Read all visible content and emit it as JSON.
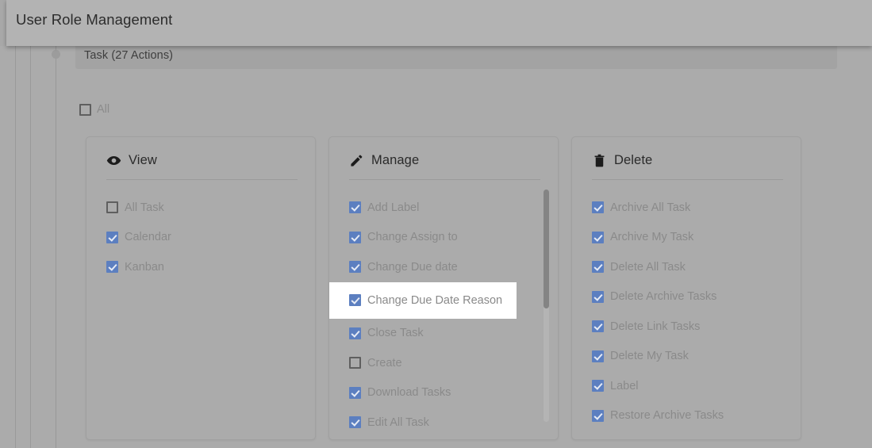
{
  "window": {
    "title": "User Role Management"
  },
  "tree": {
    "node_label": "Task  (27 Actions)"
  },
  "master": {
    "all_label": "All",
    "all_checked": false
  },
  "colors": {
    "checkbox_checked": "#5c7fc0",
    "checkbox_check_mark": "#e6ebf5",
    "checkbox_unchecked_border": "#5f5f5f",
    "page_background": "#ababab",
    "title_bar": "#b3b3b3",
    "task_band": "#a3a3a3",
    "highlight_row": "#ffffff",
    "scrollbar_thumb": "#848484",
    "scrollbar_track": "#b4b4b4",
    "label_text": "#8a8a8a",
    "heading_text": "#2a2a2a"
  },
  "cards": [
    {
      "id": "view",
      "title": "View",
      "icon": "eye-icon",
      "has_scrollbar": false,
      "options": [
        {
          "label": "All Task",
          "checked": false,
          "highlighted": false
        },
        {
          "label": "Calendar",
          "checked": true,
          "highlighted": false
        },
        {
          "label": "Kanban",
          "checked": true,
          "highlighted": false
        }
      ]
    },
    {
      "id": "manage",
      "title": "Manage",
      "icon": "pencil-icon",
      "has_scrollbar": true,
      "options": [
        {
          "label": "Add Label",
          "checked": true,
          "highlighted": false
        },
        {
          "label": "Change Assign to",
          "checked": true,
          "highlighted": false
        },
        {
          "label": "Change Due date",
          "checked": true,
          "highlighted": false
        },
        {
          "label": "Change Due Date Reason",
          "checked": true,
          "highlighted": true
        },
        {
          "label": "Close Task",
          "checked": true,
          "highlighted": false
        },
        {
          "label": "Create",
          "checked": false,
          "highlighted": false
        },
        {
          "label": "Download Tasks",
          "checked": true,
          "highlighted": false
        },
        {
          "label": "Edit All Task",
          "checked": true,
          "highlighted": false
        }
      ]
    },
    {
      "id": "delete",
      "title": "Delete",
      "icon": "trash-icon",
      "has_scrollbar": false,
      "options": [
        {
          "label": "Archive All Task",
          "checked": true,
          "highlighted": false
        },
        {
          "label": "Archive My Task",
          "checked": true,
          "highlighted": false
        },
        {
          "label": "Delete All Task",
          "checked": true,
          "highlighted": false
        },
        {
          "label": "Delete Archive Tasks",
          "checked": true,
          "highlighted": false
        },
        {
          "label": "Delete Link Tasks",
          "checked": true,
          "highlighted": false
        },
        {
          "label": "Delete My Task",
          "checked": true,
          "highlighted": false
        },
        {
          "label": "Label",
          "checked": true,
          "highlighted": false
        },
        {
          "label": "Restore Archive Tasks",
          "checked": true,
          "highlighted": false
        }
      ]
    }
  ]
}
